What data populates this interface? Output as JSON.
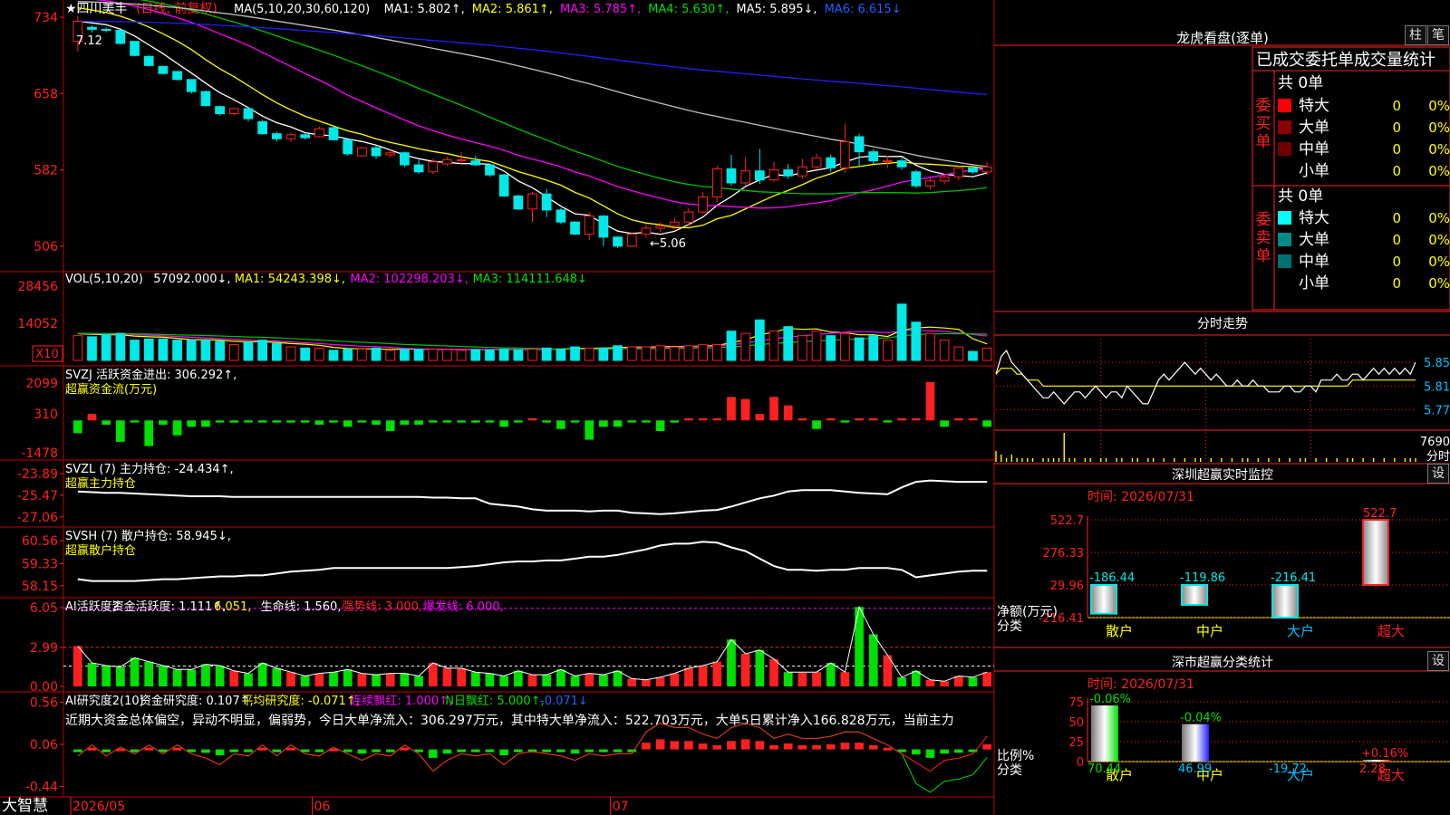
{
  "app": {
    "brand": "大智慧",
    "stock_title": "★四川美丰",
    "period": "(日线, 前复权)"
  },
  "colors": {
    "up": "#ff2020",
    "down": "#00e8e8",
    "green": "#00e000",
    "ma1": "#ffffff",
    "ma2": "#ffff00",
    "ma3": "#ff00ff",
    "ma4": "#00c000",
    "ma5": "#c0c0c0",
    "ma6": "#2020ff",
    "grid": "#c00000"
  },
  "x_axis": {
    "labels": [
      {
        "label": "2026/05",
        "index": 0
      },
      {
        "label": "06",
        "index": 17
      },
      {
        "label": "07",
        "index": 38
      }
    ],
    "bars": 60
  },
  "price_panel": {
    "legend": [
      {
        "text": "MA(5,10,20,30,60,120)",
        "color": "#ffffff"
      },
      {
        "text": "MA1: 5.802↑,",
        "color": "#ffffff"
      },
      {
        "text": "MA2: 5.861↑,",
        "color": "#ffff00"
      },
      {
        "text": "MA3: 5.785↑,",
        "color": "#ff00ff"
      },
      {
        "text": "MA4: 5.630↑,",
        "color": "#00e000"
      },
      {
        "text": "MA5: 5.895↓,",
        "color": "#ffffff"
      },
      {
        "text": "MA6: 6.615↓",
        "color": "#2060ff"
      }
    ],
    "y_ticks": [
      "734",
      "658",
      "582",
      "506"
    ],
    "ylim": [
      4.86,
      7.44
    ],
    "high_label": "7.12",
    "low_label": "←5.06",
    "candles": [
      [
        7.1,
        7.3,
        7.0,
        7.35
      ],
      [
        7.24,
        7.22,
        7.19,
        7.26
      ],
      [
        7.22,
        7.21,
        7.19,
        7.24
      ],
      [
        7.21,
        7.08,
        7.07,
        7.22
      ],
      [
        7.1,
        6.96,
        6.95,
        7.1
      ],
      [
        6.95,
        6.86,
        6.85,
        6.96
      ],
      [
        6.85,
        6.78,
        6.77,
        6.86
      ],
      [
        6.8,
        6.72,
        6.71,
        6.8
      ],
      [
        6.72,
        6.6,
        6.58,
        6.72
      ],
      [
        6.6,
        6.46,
        6.45,
        6.61
      ],
      [
        6.45,
        6.38,
        6.36,
        6.46
      ],
      [
        6.38,
        6.43,
        6.36,
        6.44
      ],
      [
        6.43,
        6.33,
        6.3,
        6.45
      ],
      [
        6.3,
        6.18,
        6.17,
        6.32
      ],
      [
        6.18,
        6.13,
        6.1,
        6.2
      ],
      [
        6.13,
        6.17,
        6.1,
        6.19
      ],
      [
        6.17,
        6.14,
        6.12,
        6.18
      ],
      [
        6.15,
        6.23,
        6.14,
        6.25
      ],
      [
        6.24,
        6.12,
        6.11,
        6.25
      ],
      [
        6.12,
        5.98,
        5.96,
        6.13
      ],
      [
        5.96,
        6.04,
        5.95,
        6.05
      ],
      [
        6.04,
        5.96,
        5.93,
        6.06
      ],
      [
        5.97,
        5.99,
        5.94,
        6.03
      ],
      [
        5.99,
        5.87,
        5.85,
        6.0
      ],
      [
        5.87,
        5.8,
        5.78,
        5.92
      ],
      [
        5.8,
        5.9,
        5.78,
        5.93
      ],
      [
        5.88,
        5.92,
        5.86,
        5.95
      ],
      [
        5.92,
        5.92,
        5.88,
        6.0
      ],
      [
        5.91,
        5.87,
        5.86,
        5.96
      ],
      [
        5.87,
        5.77,
        5.75,
        5.88
      ],
      [
        5.77,
        5.56,
        5.55,
        5.78
      ],
      [
        5.56,
        5.43,
        5.42,
        5.57
      ],
      [
        5.43,
        5.58,
        5.3,
        5.6
      ],
      [
        5.58,
        5.42,
        5.35,
        5.63
      ],
      [
        5.42,
        5.3,
        5.28,
        5.44
      ],
      [
        5.3,
        5.18,
        5.17,
        5.31
      ],
      [
        5.18,
        5.36,
        5.12,
        5.4
      ],
      [
        5.36,
        5.15,
        5.06,
        5.37
      ],
      [
        5.15,
        5.06,
        5.04,
        5.16
      ],
      [
        5.06,
        5.18,
        5.05,
        5.2
      ],
      [
        5.18,
        5.24,
        5.14,
        5.28
      ],
      [
        5.24,
        5.26,
        5.2,
        5.3
      ],
      [
        5.26,
        5.3,
        5.23,
        5.34
      ],
      [
        5.3,
        5.4,
        5.26,
        5.44
      ],
      [
        5.4,
        5.55,
        5.38,
        5.6
      ],
      [
        5.55,
        5.83,
        5.5,
        5.86
      ],
      [
        5.83,
        5.69,
        5.66,
        5.97
      ],
      [
        5.69,
        5.81,
        5.66,
        5.95
      ],
      [
        5.81,
        5.72,
        5.68,
        6.03
      ],
      [
        5.72,
        5.82,
        5.7,
        5.9
      ],
      [
        5.82,
        5.76,
        5.73,
        5.88
      ],
      [
        5.76,
        5.85,
        5.73,
        5.93
      ],
      [
        5.85,
        5.94,
        5.82,
        5.98
      ],
      [
        5.94,
        5.84,
        5.8,
        5.97
      ],
      [
        5.84,
        6.1,
        5.79,
        6.28
      ],
      [
        6.15,
        6.0,
        5.86,
        6.18
      ],
      [
        6.0,
        5.91,
        5.88,
        6.03
      ],
      [
        5.91,
        5.91,
        5.84,
        5.96
      ],
      [
        5.91,
        5.85,
        5.82,
        5.94
      ],
      [
        5.8,
        5.66,
        5.64,
        5.82
      ],
      [
        5.66,
        5.71,
        5.62,
        5.74
      ],
      [
        5.71,
        5.75,
        5.68,
        5.78
      ],
      [
        5.75,
        5.84,
        5.72,
        5.86
      ],
      [
        5.84,
        5.8,
        5.78,
        5.86
      ],
      [
        5.8,
        5.85,
        5.77,
        5.9
      ]
    ]
  },
  "volume_panel": {
    "legend": [
      {
        "text": "VOL(5,10,20)",
        "color": "#ffffff"
      },
      {
        "text": "57092.000↓,",
        "color": "#ffffff"
      },
      {
        "text": "MA1: 54243.398↓,",
        "color": "#ffff00"
      },
      {
        "text": "MA2: 102298.203↓,",
        "color": "#ff00ff"
      },
      {
        "text": "MA3: 114111.648↓",
        "color": "#00e000"
      }
    ],
    "y_ticks": [
      "28456",
      "14052"
    ],
    "unit": "X10",
    "ylim": [
      0,
      37000
    ],
    "values": [
      11000,
      10500,
      11500,
      12000,
      9000,
      9500,
      9500,
      9000,
      9000,
      9000,
      8500,
      7000,
      8000,
      9000,
      7500,
      6000,
      5500,
      5500,
      4500,
      5000,
      5000,
      5500,
      4500,
      5000,
      5000,
      5000,
      4800,
      4500,
      4800,
      4700,
      5000,
      4800,
      5000,
      5500,
      5000,
      6000,
      5500,
      5500,
      6500,
      6000,
      6000,
      6500,
      6000,
      6500,
      7000,
      7000,
      13000,
      12000,
      18000,
      13000,
      15000,
      11000,
      13000,
      11000,
      12000,
      10000,
      11000,
      9000,
      25000,
      17000,
      12000,
      9000,
      6000,
      4000,
      5500
    ]
  },
  "fund_flow_panel": {
    "legend": [
      {
        "text": "SVZJ  活跃资金进出: 306.292↑,",
        "color": "#ffffff"
      },
      {
        "text": "超赢资金流(万元)",
        "color": "#ffff00"
      }
    ],
    "y_ticks": [
      "2099",
      "310",
      "-1478"
    ],
    "ylim": [
      -1600,
      2300
    ],
    "values": [
      -600,
      300,
      -200,
      -1000,
      -100,
      -1200,
      -200,
      -700,
      -300,
      -300,
      -100,
      -100,
      -100,
      -100,
      -100,
      -100,
      -100,
      -200,
      -100,
      -300,
      -100,
      -200,
      -500,
      -200,
      -200,
      -100,
      -100,
      -100,
      -100,
      -100,
      -300,
      -100,
      100,
      -100,
      -400,
      -100,
      -900,
      -300,
      -300,
      -100,
      -100,
      -500,
      -100,
      100,
      100,
      100,
      1100,
      1000,
      300,
      1100,
      700,
      100,
      -400,
      100,
      -100,
      100,
      100,
      -100,
      100,
      100,
      1800,
      -300,
      100,
      100,
      -300
    ]
  },
  "main_position_panel": {
    "legend": [
      {
        "text": "SVZL  (7) 主力持仓: -24.434↑,",
        "color": "#ffffff"
      },
      {
        "text": "超赢主力持仓",
        "color": "#ffff00"
      }
    ],
    "y_ticks": [
      "-23.89",
      "-25.47",
      "-27.06"
    ],
    "ylim": [
      -27.4,
      -23.3
    ],
    "values": [
      -25.2,
      -25.25,
      -25.3,
      -25.3,
      -25.35,
      -25.4,
      -25.45,
      -25.5,
      -25.55,
      -25.55,
      -25.55,
      -25.6,
      -25.6,
      -25.6,
      -25.6,
      -25.6,
      -25.6,
      -25.6,
      -25.6,
      -25.6,
      -25.6,
      -25.6,
      -25.6,
      -25.6,
      -25.6,
      -25.65,
      -25.65,
      -25.7,
      -25.7,
      -26.1,
      -26.2,
      -26.3,
      -26.5,
      -26.6,
      -26.6,
      -26.6,
      -26.65,
      -26.6,
      -26.6,
      -26.75,
      -26.8,
      -26.85,
      -26.8,
      -26.7,
      -26.6,
      -26.55,
      -26.3,
      -26.0,
      -25.7,
      -25.5,
      -25.2,
      -25.1,
      -25.1,
      -25.1,
      -25.2,
      -25.3,
      -25.35,
      -25.4,
      -24.9,
      -24.5,
      -24.4,
      -24.45,
      -24.5,
      -24.5,
      -24.5
    ]
  },
  "retail_position_panel": {
    "legend": [
      {
        "text": "SVSH  (7) 散户持仓: 58.945↓,",
        "color": "#ffffff"
      },
      {
        "text": "超赢散户持仓",
        "color": "#ffff00"
      }
    ],
    "y_ticks": [
      "60.56",
      "59.33",
      "58.15"
    ],
    "ylim": [
      57.8,
      61.0
    ],
    "values": [
      58.5,
      58.4,
      58.4,
      58.4,
      58.4,
      58.45,
      58.5,
      58.5,
      58.55,
      58.6,
      58.65,
      58.65,
      58.7,
      58.7,
      58.8,
      58.9,
      58.95,
      59.0,
      59.1,
      59.1,
      59.1,
      59.1,
      59.1,
      59.1,
      59.1,
      59.1,
      59.1,
      59.15,
      59.2,
      59.3,
      59.4,
      59.45,
      59.45,
      59.5,
      59.5,
      59.6,
      59.7,
      59.7,
      59.8,
      59.95,
      60.1,
      60.3,
      60.4,
      60.4,
      60.5,
      60.45,
      60.2,
      60.0,
      59.6,
      59.2,
      59.0,
      59.0,
      58.95,
      59.0,
      59.0,
      59.1,
      59.1,
      59.1,
      59.0,
      58.6,
      58.7,
      58.8,
      58.9,
      58.95,
      58.95
    ]
  },
  "activity_panel": {
    "legend": [
      {
        "text": "AI活跃度2",
        "color": "#ffffff"
      },
      {
        "text": "资金活跃度: 1.111↑,",
        "color": "#ffffff"
      },
      {
        "text": "6.051,",
        "color": "#ffff00"
      },
      {
        "text": "生命线: 1.560,",
        "color": "#ffffff"
      },
      {
        "text": "强势线: 3.000,",
        "color": "#ff2020"
      },
      {
        "text": "爆发线: 6.000,",
        "color": "#ff00ff"
      }
    ],
    "y_ticks": [
      "6.05",
      "2.99",
      "0.00"
    ],
    "ylim": [
      0,
      6.4
    ],
    "strong_line": 3.0,
    "burst_line": 6.0,
    "life_line": 1.56,
    "values": [
      3.1,
      1.8,
      1.6,
      1.5,
      2.2,
      1.9,
      1.6,
      1.3,
      1.3,
      1.7,
      1.6,
      1.2,
      1.0,
      1.8,
      1.4,
      1.1,
      0.8,
      1.0,
      1.1,
      1.3,
      1.0,
      0.9,
      1.0,
      1.0,
      0.8,
      1.8,
      1.4,
      1.4,
      1.1,
      1.0,
      0.8,
      1.2,
      0.9,
      0.9,
      1.3,
      0.8,
      1.0,
      0.9,
      1.2,
      0.6,
      0.5,
      0.7,
      1.0,
      1.4,
      1.6,
      1.9,
      3.6,
      2.5,
      2.8,
      2.1,
      1.1,
      1.1,
      1.1,
      1.8,
      1.1,
      6.1,
      4.0,
      2.4,
      0.7,
      1.2,
      0.5,
      0.4,
      0.8,
      0.7,
      1.1
    ]
  },
  "research_panel": {
    "legend": [
      {
        "text": "AI研究度2(10)",
        "color": "#ffffff"
      },
      {
        "text": "资金研究度: 0.107↑,",
        "color": "#ffffff"
      },
      {
        "text": "平均研究度: -0.071↑,",
        "color": "#ffff00"
      },
      {
        "text": "连续飘红: 1.000↑,",
        "color": "#ff00ff"
      },
      {
        "text": "N日飘红: 5.000↑,",
        "color": "#00e000"
      },
      {
        "text": "-0.071↓",
        "color": "#2060ff"
      }
    ],
    "comment": "近期大资金总体偏空，异动不明显，偏弱势，今日大单净流入：306.297万元，其中特大单净流入：522.703万元，大单5日累计净入166.828万元，当前主力",
    "y_ticks": [
      "0.56",
      "0.06",
      "-0.44"
    ],
    "ylim": [
      -0.5,
      0.62
    ],
    "values": [
      -0.03,
      0.02,
      -0.03,
      0.01,
      -0.02,
      0.02,
      -0.02,
      0.02,
      -0.02,
      -0.04,
      -0.07,
      -0.02,
      -0.03,
      0.02,
      -0.03,
      0.02,
      -0.02,
      -0.03,
      0.01,
      -0.02,
      -0.05,
      -0.02,
      -0.03,
      0.02,
      -0.02,
      -0.1,
      -0.05,
      -0.02,
      -0.03,
      -0.02,
      -0.07,
      -0.02,
      -0.01,
      -0.02,
      -0.03,
      -0.05,
      -0.02,
      -0.03,
      -0.02,
      -0.02,
      0.08,
      0.12,
      0.1,
      0.1,
      0.07,
      0.05,
      0.1,
      0.12,
      0.1,
      0.05,
      0.07,
      0.05,
      0.05,
      0.06,
      0.08,
      0.08,
      0.05,
      0.02,
      -0.02,
      -0.06,
      -0.1,
      -0.05,
      -0.04,
      -0.02,
      0.06
    ]
  },
  "dragon_tiger": {
    "title": "龙虎看盘(逐单)",
    "btn_bar": "柱",
    "btn_pen": "笔",
    "header": "已成交委托单成交量统计",
    "buy_label": "委买单",
    "sell_label": "委卖单",
    "buy_total": "共 0单",
    "sell_total": "共 0单",
    "buy_rows": [
      {
        "label": "特大",
        "count": "0",
        "pct": "0%",
        "color": "#ff0000"
      },
      {
        "label": "大单",
        "count": "0",
        "pct": "0%",
        "color": "#8b0000"
      },
      {
        "label": "中单",
        "count": "0",
        "pct": "0%",
        "color": "#700000"
      },
      {
        "label": "小单",
        "count": "0",
        "pct": "0%",
        "color": "#000000"
      }
    ],
    "sell_rows": [
      {
        "label": "特大",
        "count": "0",
        "pct": "0%",
        "color": "#00ffff"
      },
      {
        "label": "大单",
        "count": "0",
        "pct": "0%",
        "color": "#008b8b"
      },
      {
        "label": "中单",
        "count": "0",
        "pct": "0%",
        "color": "#007070"
      },
      {
        "label": "小单",
        "count": "0",
        "pct": "0%",
        "color": "#000000"
      }
    ]
  },
  "intraday": {
    "title": "分时走势",
    "y_ticks": [
      "5.85",
      "5.81",
      "5.77"
    ],
    "vol_label": "7690",
    "vol_unit": "分时",
    "ylim": [
      5.74,
      5.89
    ],
    "price": [
      5.83,
      5.86,
      5.87,
      5.85,
      5.84,
      5.83,
      5.82,
      5.81,
      5.8,
      5.79,
      5.79,
      5.8,
      5.79,
      5.78,
      5.79,
      5.8,
      5.8,
      5.79,
      5.8,
      5.81,
      5.8,
      5.79,
      5.8,
      5.8,
      5.79,
      5.81,
      5.8,
      5.79,
      5.78,
      5.78,
      5.8,
      5.82,
      5.83,
      5.82,
      5.83,
      5.84,
      5.85,
      5.84,
      5.83,
      5.84,
      5.83,
      5.82,
      5.83,
      5.82,
      5.81,
      5.81,
      5.82,
      5.81,
      5.81,
      5.82,
      5.81,
      5.81,
      5.8,
      5.8,
      5.8,
      5.81,
      5.81,
      5.8,
      5.8,
      5.81,
      5.81,
      5.8,
      5.82,
      5.82,
      5.82,
      5.83,
      5.82,
      5.82,
      5.83,
      5.83,
      5.82,
      5.83,
      5.84,
      5.83,
      5.84,
      5.83,
      5.84,
      5.83,
      5.84,
      5.83,
      5.85
    ],
    "avg": [
      5.83,
      5.84,
      5.84,
      5.84,
      5.83,
      5.83,
      5.82,
      5.82,
      5.82,
      5.81,
      5.81,
      5.81,
      5.81,
      5.81,
      5.81,
      5.81,
      5.81,
      5.81,
      5.81,
      5.81,
      5.81,
      5.81,
      5.81,
      5.81,
      5.81,
      5.81,
      5.81,
      5.81,
      5.81,
      5.81,
      5.81,
      5.81,
      5.81,
      5.81,
      5.81,
      5.81,
      5.81,
      5.81,
      5.81,
      5.81,
      5.81,
      5.81,
      5.81,
      5.81,
      5.81,
      5.81,
      5.81,
      5.81,
      5.81,
      5.81,
      5.81,
      5.81,
      5.81,
      5.81,
      5.81,
      5.81,
      5.81,
      5.81,
      5.81,
      5.81,
      5.81,
      5.81,
      5.81,
      5.81,
      5.81,
      5.81,
      5.81,
      5.81,
      5.82,
      5.82,
      5.82,
      5.82,
      5.82,
      5.82,
      5.82,
      5.82,
      5.82,
      5.82,
      5.82,
      5.82,
      5.82
    ],
    "volume": [
      3,
      2,
      1,
      2,
      1,
      1,
      1,
      1,
      0,
      1,
      1,
      1,
      1,
      8,
      1,
      1,
      0,
      1,
      1,
      0,
      1,
      1,
      0,
      1,
      1,
      0,
      1,
      1,
      0,
      1,
      1,
      0,
      1,
      0,
      1,
      0,
      1,
      0,
      1,
      1,
      0,
      1,
      0,
      1,
      0,
      1,
      0,
      1,
      1,
      0,
      1,
      0,
      1,
      0,
      1,
      0,
      1,
      0,
      1,
      1,
      0,
      1,
      0,
      1,
      0,
      1,
      0,
      1,
      1,
      0,
      1,
      0,
      1,
      0,
      1,
      0,
      1,
      0,
      1,
      1,
      1
    ]
  },
  "monitor": {
    "title": "深圳超赢实时监控",
    "set_label": "设",
    "time": "时间: 2026/07/31",
    "y_ticks": [
      "522.7",
      "276.33",
      "29.96",
      "-216.41"
    ],
    "y_title": "净额(万元)",
    "x_title": "分类",
    "ylim": [
      -216.41,
      522.7
    ],
    "categories": [
      "散户",
      "中户",
      "大户",
      "超大"
    ],
    "values": [
      -186.44,
      -119.86,
      -216.41,
      522.7
    ],
    "value_labels": [
      "-186.44",
      "-119.86",
      "-216.41",
      "522.7"
    ]
  },
  "classify": {
    "title": "深市超赢分类统计",
    "set_label": "设",
    "time": "时间: 2026/07/31",
    "y_ticks": [
      "75",
      "50",
      "25",
      "0"
    ],
    "y_title": "比例%",
    "x_title": "分类",
    "ylim": [
      0,
      75
    ],
    "categories": [
      "散户",
      "中户",
      "大户",
      "超大"
    ],
    "values": [
      70.44,
      46.99,
      -19.72,
      2.28
    ],
    "top_labels": [
      "-0.06%",
      "-0.04%",
      "",
      "+0.16%"
    ],
    "value_labels": [
      "70.44",
      "46.99",
      "-19.72",
      "2.28"
    ]
  }
}
